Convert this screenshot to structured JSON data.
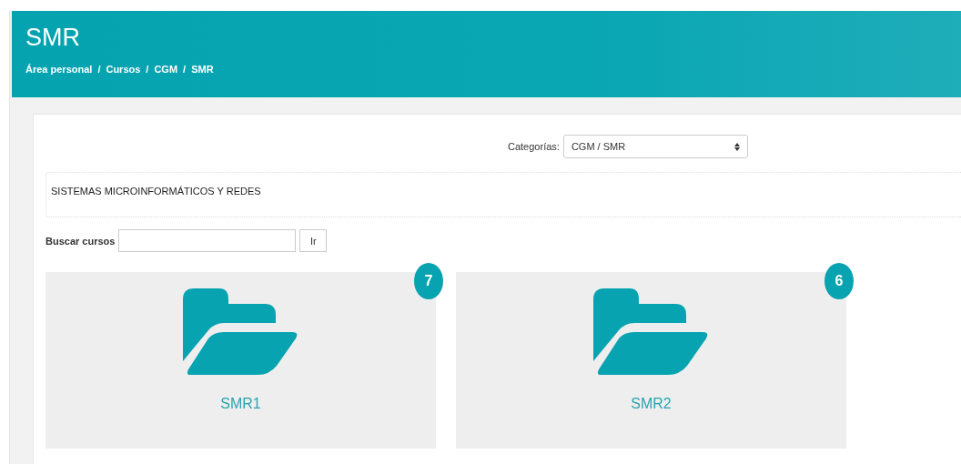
{
  "header": {
    "title": "SMR",
    "breadcrumb": [
      "Área personal",
      "Cursos",
      "CGM",
      "SMR"
    ],
    "separator": "/"
  },
  "category_select": {
    "label": "Categorías:",
    "value": "CGM / SMR"
  },
  "description": "SISTEMAS MICROINFORMÁTICOS Y REDES",
  "search": {
    "label": "Buscar cursos",
    "button": "Ir"
  },
  "categories": [
    {
      "name": "SMR1",
      "count": "7"
    },
    {
      "name": "SMR2",
      "count": "6"
    }
  ]
}
